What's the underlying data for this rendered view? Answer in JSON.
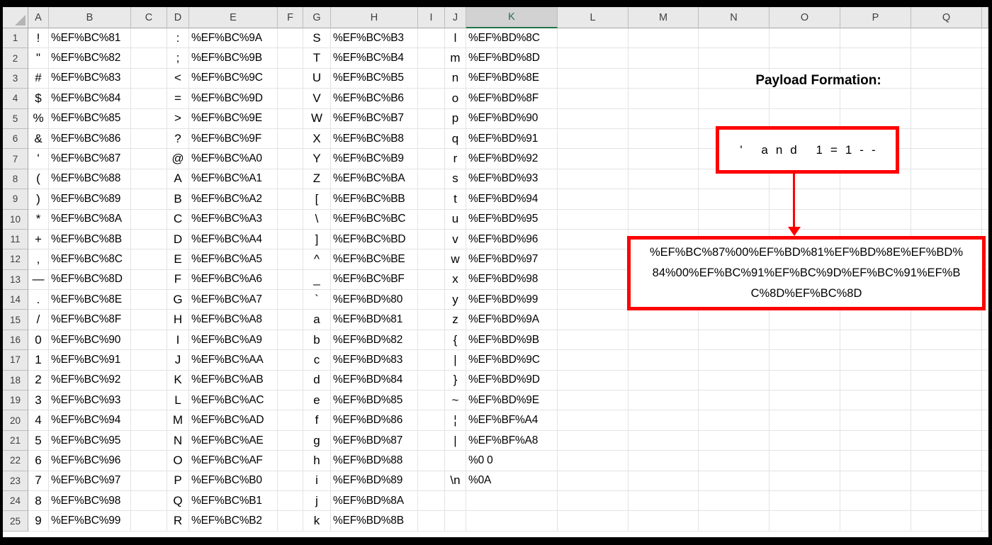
{
  "sheet": {
    "selected_column": "K",
    "column_headers": [
      "A",
      "B",
      "C",
      "D",
      "E",
      "F",
      "G",
      "H",
      "I",
      "J",
      "K",
      "L",
      "M",
      "N",
      "O",
      "P",
      "Q"
    ],
    "rows": [
      {
        "n": "1",
        "cells": {
          "A": "!",
          "B": "%EF%BC%81",
          "D": ":",
          "E": "%EF%BC%9A",
          "G": "S",
          "H": "%EF%BC%B3",
          "J": "l",
          "K": "%EF%BD%8C"
        }
      },
      {
        "n": "2",
        "cells": {
          "A": "\"",
          "B": "%EF%BC%82",
          "D": ";",
          "E": "%EF%BC%9B",
          "G": "T",
          "H": "%EF%BC%B4",
          "J": "m",
          "K": "%EF%BD%8D"
        }
      },
      {
        "n": "3",
        "cells": {
          "A": "#",
          "B": "%EF%BC%83",
          "D": "<",
          "E": "%EF%BC%9C",
          "G": "U",
          "H": "%EF%BC%B5",
          "J": "n",
          "K": "%EF%BD%8E"
        }
      },
      {
        "n": "4",
        "cells": {
          "A": "$",
          "B": "%EF%BC%84",
          "D": "=",
          "E": "%EF%BC%9D",
          "G": "V",
          "H": "%EF%BC%B6",
          "J": "o",
          "K": "%EF%BD%8F"
        }
      },
      {
        "n": "5",
        "cells": {
          "A": "%",
          "B": "%EF%BC%85",
          "D": ">",
          "E": "%EF%BC%9E",
          "G": "W",
          "H": "%EF%BC%B7",
          "J": "p",
          "K": "%EF%BD%90"
        }
      },
      {
        "n": "6",
        "cells": {
          "A": "&",
          "B": "%EF%BC%86",
          "D": "?",
          "E": "%EF%BC%9F",
          "G": "X",
          "H": "%EF%BC%B8",
          "J": "q",
          "K": "%EF%BD%91"
        }
      },
      {
        "n": "7",
        "cells": {
          "A": "'",
          "B": "%EF%BC%87",
          "D": "@",
          "E": "%EF%BC%A0",
          "G": "Y",
          "H": "%EF%BC%B9",
          "J": "r",
          "K": "%EF%BD%92"
        }
      },
      {
        "n": "8",
        "cells": {
          "A": "(",
          "B": "%EF%BC%88",
          "D": "A",
          "E": "%EF%BC%A1",
          "G": "Z",
          "H": "%EF%BC%BA",
          "J": "s",
          "K": "%EF%BD%93"
        }
      },
      {
        "n": "9",
        "cells": {
          "A": ")",
          "B": "%EF%BC%89",
          "D": "B",
          "E": "%EF%BC%A2",
          "G": "[",
          "H": "%EF%BC%BB",
          "J": "t",
          "K": "%EF%BD%94"
        }
      },
      {
        "n": "10",
        "cells": {
          "A": "*",
          "B": "%EF%BC%8A",
          "D": "C",
          "E": "%EF%BC%A3",
          "G": "\\",
          "H": "%EF%BC%BC",
          "J": "u",
          "K": "%EF%BD%95"
        }
      },
      {
        "n": "11",
        "cells": {
          "A": "+",
          "B": "%EF%BC%8B",
          "D": "D",
          "E": "%EF%BC%A4",
          "G": "]",
          "H": "%EF%BC%BD",
          "J": "v",
          "K": "%EF%BD%96"
        }
      },
      {
        "n": "12",
        "cells": {
          "A": ",",
          "B": "%EF%BC%8C",
          "D": "E",
          "E": "%EF%BC%A5",
          "G": "^",
          "H": "%EF%BC%BE",
          "J": "w",
          "K": "%EF%BD%97"
        }
      },
      {
        "n": "13",
        "cells": {
          "A": "—",
          "B": "%EF%BC%8D",
          "D": "F",
          "E": "%EF%BC%A6",
          "G": "_",
          "H": "%EF%BC%BF",
          "J": "x",
          "K": "%EF%BD%98"
        }
      },
      {
        "n": "14",
        "cells": {
          "A": ".",
          "B": "%EF%BC%8E",
          "D": "G",
          "E": "%EF%BC%A7",
          "G": "`",
          "H": "%EF%BD%80",
          "J": "y",
          "K": "%EF%BD%99"
        }
      },
      {
        "n": "15",
        "cells": {
          "A": "/",
          "B": "%EF%BC%8F",
          "D": "H",
          "E": "%EF%BC%A8",
          "G": "a",
          "H": "%EF%BD%81",
          "J": "z",
          "K": "%EF%BD%9A"
        }
      },
      {
        "n": "16",
        "cells": {
          "A": "0",
          "B": "%EF%BC%90",
          "D": "I",
          "E": "%EF%BC%A9",
          "G": "b",
          "H": "%EF%BD%82",
          "J": "{",
          "K": "%EF%BD%9B"
        }
      },
      {
        "n": "17",
        "cells": {
          "A": "1",
          "B": "%EF%BC%91",
          "D": "J",
          "E": "%EF%BC%AA",
          "G": "c",
          "H": "%EF%BD%83",
          "J": "|",
          "K": "%EF%BD%9C"
        }
      },
      {
        "n": "18",
        "cells": {
          "A": "2",
          "B": "%EF%BC%92",
          "D": "K",
          "E": "%EF%BC%AB",
          "G": "d",
          "H": "%EF%BD%84",
          "J": "}",
          "K": "%EF%BD%9D"
        }
      },
      {
        "n": "19",
        "cells": {
          "A": "3",
          "B": "%EF%BC%93",
          "D": "L",
          "E": "%EF%BC%AC",
          "G": "e",
          "H": "%EF%BD%85",
          "J": "~",
          "K": "%EF%BD%9E"
        }
      },
      {
        "n": "20",
        "cells": {
          "A": "4",
          "B": "%EF%BC%94",
          "D": "M",
          "E": "%EF%BC%AD",
          "G": "f",
          "H": "%EF%BD%86",
          "J": "¦",
          "K": "%EF%BF%A4"
        }
      },
      {
        "n": "21",
        "cells": {
          "A": "5",
          "B": "%EF%BC%95",
          "D": "N",
          "E": "%EF%BC%AE",
          "G": "g",
          "H": "%EF%BD%87",
          "J": "|",
          "K": "%EF%BF%A8"
        }
      },
      {
        "n": "22",
        "cells": {
          "A": "6",
          "B": "%EF%BC%96",
          "D": "O",
          "E": "%EF%BC%AF",
          "G": "h",
          "H": "%EF%BD%88",
          "K": "%0 0"
        }
      },
      {
        "n": "23",
        "cells": {
          "A": "7",
          "B": "%EF%BC%97",
          "D": "P",
          "E": "%EF%BC%B0",
          "G": "i",
          "H": "%EF%BD%89",
          "J": "\\n",
          "K": "%0A"
        }
      },
      {
        "n": "24",
        "cells": {
          "A": "8",
          "B": "%EF%BC%98",
          "D": "Q",
          "E": "%EF%BC%B1",
          "G": "j",
          "H": "%EF%BD%8A"
        }
      },
      {
        "n": "25",
        "cells": {
          "A": "9",
          "B": "%EF%BC%99",
          "D": "R",
          "E": "%EF%BC%B2",
          "G": "k",
          "H": "%EF%BD%8B"
        }
      }
    ]
  },
  "annotation": {
    "title": "Payload Formation:",
    "payload_text": "' and 1=1--",
    "encoded_payload": "%EF%BC%87%00%EF%BD%81%EF%BD%8E%EF%BD%84%00%EF%BC%91%EF%BC%9D%EF%BC%91%EF%BC%8D%EF%BC%8D"
  },
  "colors": {
    "shape_red": "#FE0000",
    "selected_green": "#217346",
    "header_gray": "#E9E9E9"
  }
}
